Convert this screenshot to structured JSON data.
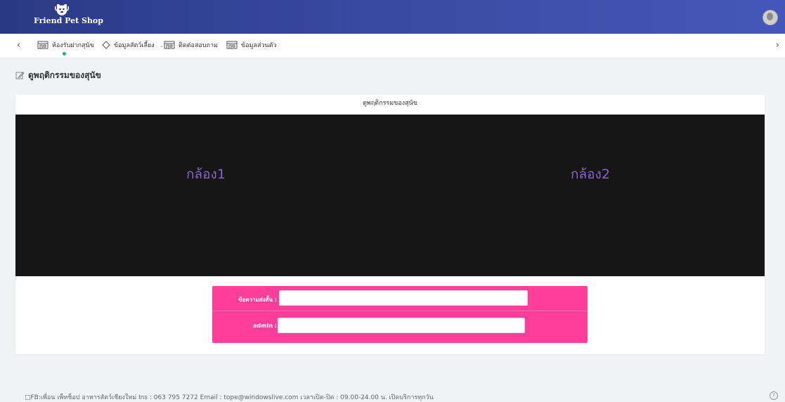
{
  "app": {
    "brand": "Friend Pet Shop",
    "accent_color": "#3b4aa3",
    "pink_color": "#ff3d9b",
    "camera_text_color": "#8a63c7"
  },
  "nav": {
    "prev_icon": "chevron-left-icon",
    "next_icon": "chevron-right-icon",
    "items": [
      {
        "label": "ห้องรับฝากสุนัข",
        "icon": "building-icon",
        "active": true
      },
      {
        "label": "ข้อมูลสัตว์เลี้ยง",
        "icon": "diamond-icon",
        "dropdown": true
      },
      {
        "label": "ติดต่อสอบถาม",
        "icon": "building-icon"
      },
      {
        "label": "ข้อมูลส่วนตัว",
        "icon": "building-icon"
      }
    ]
  },
  "page": {
    "title": "ดูพฤติกรรมของสุนัข"
  },
  "card": {
    "title": "ดูพฤติกรรมของสุนัข",
    "camera1": "กล้อง1",
    "camera2": "กล้อง2"
  },
  "form": {
    "message_label": "ข้อความส่งสั้น :",
    "message_value": "",
    "admin_label": "admin :",
    "admin_value": ""
  },
  "footer": {
    "text": "□FB:เพื่อน เพ็ทช็อป อาหารสัตว์เชียงใหม่  Ins : 063 795 7272  Email : tope@windowslive.com  เวลาเปิด-ปิด : 09.00-24.00 น. เปิดบริการทุกวัน",
    "help_icon": "question-icon"
  }
}
